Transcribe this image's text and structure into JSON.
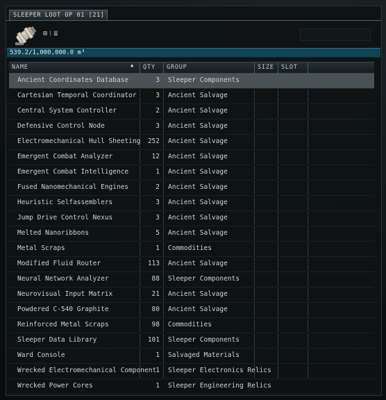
{
  "window": {
    "tab_label": "SLEEPER LOOT OP 01 [21]"
  },
  "toolbar": {
    "view_icons": [
      "⊞",
      "⁝",
      "≣"
    ]
  },
  "capacity": {
    "text": "539.2/1,000,000.0 m³"
  },
  "columns": {
    "name": "NAME",
    "qty": "QTY",
    "group": "GROUP",
    "size": "SIZE",
    "slot": "SLOT"
  },
  "sort_icon": "▲",
  "items": [
    {
      "name": "Ancient Coordinates Database",
      "qty": "3",
      "group": "Sleeper Components"
    },
    {
      "name": "Cartesian Temporal Coordinator",
      "qty": "3",
      "group": "Ancient Salvage"
    },
    {
      "name": "Central System Controller",
      "qty": "2",
      "group": "Ancient Salvage"
    },
    {
      "name": "Defensive Control Node",
      "qty": "3",
      "group": "Ancient Salvage"
    },
    {
      "name": "Electromechanical Hull Sheeting",
      "qty": "252",
      "group": "Ancient Salvage"
    },
    {
      "name": "Emergent Combat Analyzer",
      "qty": "12",
      "group": "Ancient Salvage"
    },
    {
      "name": "Emergent Combat Intelligence",
      "qty": "1",
      "group": "Ancient Salvage"
    },
    {
      "name": "Fused Nanomechanical Engines",
      "qty": "2",
      "group": "Ancient Salvage"
    },
    {
      "name": "Heuristic Selfassemblers",
      "qty": "3",
      "group": "Ancient Salvage"
    },
    {
      "name": "Jump Drive Control Nexus",
      "qty": "3",
      "group": "Ancient Salvage"
    },
    {
      "name": "Melted Nanoribbons",
      "qty": "5",
      "group": "Ancient Salvage"
    },
    {
      "name": "Metal Scraps",
      "qty": "1",
      "group": "Commodities"
    },
    {
      "name": "Modified Fluid Router",
      "qty": "113",
      "group": "Ancient Salvage"
    },
    {
      "name": "Neural Network Analyzer",
      "qty": "88",
      "group": "Sleeper Components"
    },
    {
      "name": "Neurovisual Input Matrix",
      "qty": "21",
      "group": "Ancient Salvage"
    },
    {
      "name": "Powdered C-540 Graphite",
      "qty": "80",
      "group": "Ancient Salvage"
    },
    {
      "name": "Reinforced Metal Scraps",
      "qty": "98",
      "group": "Commodities"
    },
    {
      "name": "Sleeper Data Library",
      "qty": "101",
      "group": "Sleeper Components"
    },
    {
      "name": "Ward Console",
      "qty": "1",
      "group": "Salvaged Materials"
    },
    {
      "name": "Wrecked Electromechanical Component",
      "qty": "1",
      "group": "Sleeper Electronics Relics"
    },
    {
      "name": "Wrecked Power Cores",
      "qty": "1",
      "group": "Sleeper Engineering Relics"
    }
  ],
  "selected_index": 0
}
